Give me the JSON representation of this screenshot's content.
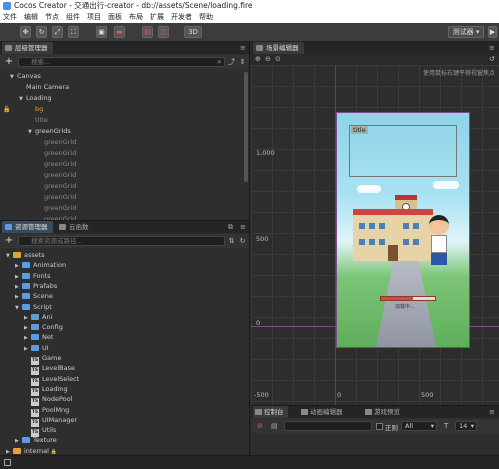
{
  "window": {
    "title": "Cocos Creator - 交通出行-creator - db://assets/Scene/loading.fire"
  },
  "menu": [
    "文件",
    "编辑",
    "节点",
    "组件",
    "项目",
    "面板",
    "布局",
    "扩展",
    "开发者",
    "帮助"
  ],
  "toolbar": {
    "mode_3d": "3D",
    "device": "测试器",
    "device_arrow": "▾"
  },
  "hierarchy": {
    "tab": "层级管理器",
    "search_placeholder": "搜索...",
    "nodes": [
      {
        "label": "Canvas",
        "arrow": "▼",
        "level": 0,
        "style": "normal"
      },
      {
        "label": "Main Camera",
        "arrow": "",
        "level": 1,
        "style": "normal"
      },
      {
        "label": "Loading",
        "arrow": "▼",
        "level": 1,
        "style": "normal"
      },
      {
        "label": "bg",
        "arrow": "",
        "level": 2,
        "style": "orange"
      },
      {
        "label": "title",
        "arrow": "",
        "level": 2,
        "style": "dim"
      },
      {
        "label": "greenGrids",
        "arrow": "▼",
        "level": 2,
        "style": "normal"
      },
      {
        "label": "greenGrid",
        "arrow": "",
        "level": 3,
        "style": "dim"
      },
      {
        "label": "greenGrid",
        "arrow": "",
        "level": 3,
        "style": "dim"
      },
      {
        "label": "greenGrid",
        "arrow": "",
        "level": 3,
        "style": "dim"
      },
      {
        "label": "greenGrid",
        "arrow": "",
        "level": 3,
        "style": "dim"
      },
      {
        "label": "greenGrid",
        "arrow": "",
        "level": 3,
        "style": "dim"
      },
      {
        "label": "greenGrid",
        "arrow": "",
        "level": 3,
        "style": "dim"
      },
      {
        "label": "greenGrid",
        "arrow": "",
        "level": 3,
        "style": "dim"
      },
      {
        "label": "greenGrid",
        "arrow": "",
        "level": 3,
        "style": "dim"
      }
    ]
  },
  "assets": {
    "tab": "资源管理器",
    "tab2": "云函数",
    "search_placeholder": "搜索资源或路径...",
    "items": [
      {
        "label": "assets",
        "arrow": "▼",
        "level": 0,
        "icon": "folder-yellow"
      },
      {
        "label": "Animation",
        "arrow": "▶",
        "level": 1,
        "icon": "folder"
      },
      {
        "label": "Fonts",
        "arrow": "▶",
        "level": 1,
        "icon": "folder"
      },
      {
        "label": "Prafabs",
        "arrow": "▶",
        "level": 1,
        "icon": "folder"
      },
      {
        "label": "Scene",
        "arrow": "▶",
        "level": 1,
        "icon": "folder"
      },
      {
        "label": "Script",
        "arrow": "▼",
        "level": 1,
        "icon": "folder"
      },
      {
        "label": "Ani",
        "arrow": "▶",
        "level": 2,
        "icon": "folder"
      },
      {
        "label": "Config",
        "arrow": "▶",
        "level": 2,
        "icon": "folder"
      },
      {
        "label": "Net",
        "arrow": "▶",
        "level": 2,
        "icon": "folder"
      },
      {
        "label": "UI",
        "arrow": "▶",
        "level": 2,
        "icon": "folder"
      },
      {
        "label": "Game",
        "arrow": "",
        "level": 2,
        "icon": "ts"
      },
      {
        "label": "LevelBase",
        "arrow": "",
        "level": 2,
        "icon": "ts"
      },
      {
        "label": "LevelSelect",
        "arrow": "",
        "level": 2,
        "icon": "ts"
      },
      {
        "label": "Loading",
        "arrow": "",
        "level": 2,
        "icon": "ts"
      },
      {
        "label": "NodePool",
        "arrow": "",
        "level": 2,
        "icon": "ts"
      },
      {
        "label": "PoolMng",
        "arrow": "",
        "level": 2,
        "icon": "ts"
      },
      {
        "label": "UIManager",
        "arrow": "",
        "level": 2,
        "icon": "ts"
      },
      {
        "label": "Utils",
        "arrow": "",
        "level": 2,
        "icon": "ts"
      },
      {
        "label": "Texture",
        "arrow": "▶",
        "level": 1,
        "icon": "folder"
      },
      {
        "label": "internal",
        "arrow": "▶",
        "level": 0,
        "icon": "folder-yellow",
        "locked": true
      }
    ]
  },
  "scene": {
    "tab": "场景编辑器",
    "hint": "使用鼠标右键平移视窗焦点",
    "y_labels": [
      "1,000",
      "500",
      "0",
      "-500"
    ],
    "x_labels": [
      "0",
      "500"
    ],
    "game": {
      "title": "title",
      "loading_text": "加载中...",
      "progress": 0.6
    }
  },
  "console": {
    "tabs": [
      "控制台",
      "动画编辑器",
      "游戏预览"
    ],
    "regex_label": "正则",
    "filter_value": "All",
    "font_size": "14"
  }
}
